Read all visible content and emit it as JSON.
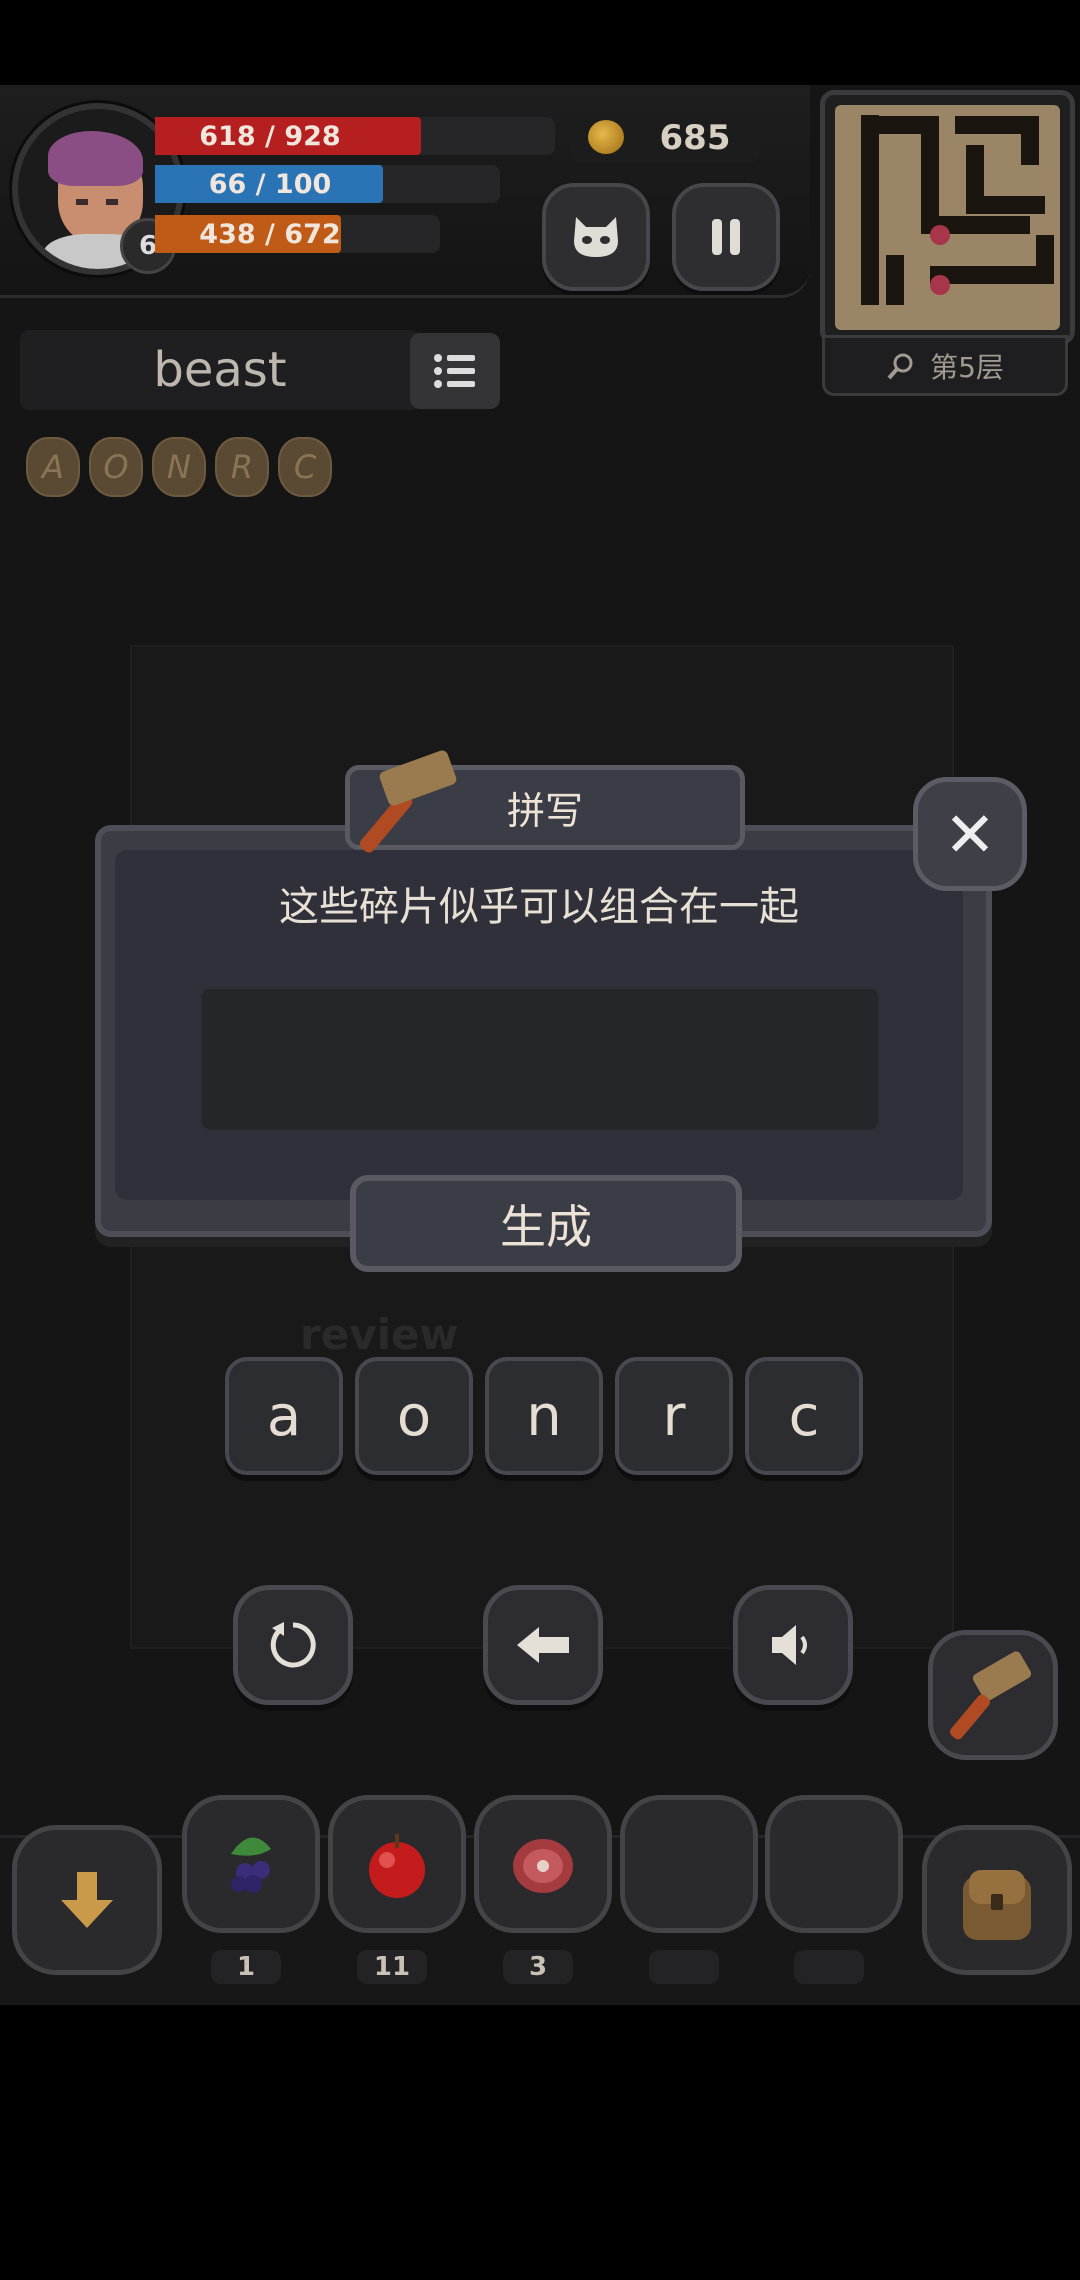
{
  "player": {
    "level": "6",
    "hp": "618 / 928",
    "hp_fraction": 0.666,
    "mp": "66 / 100",
    "mp_fraction": 0.66,
    "xp": "438 / 672",
    "xp_fraction": 0.652
  },
  "coins": "685",
  "floor_label": "第5层",
  "current_word": "beast",
  "fragments": [
    "A",
    "O",
    "N",
    "R",
    "C"
  ],
  "dialog": {
    "title": "拼写",
    "prompt": "这些碎片似乎可以组合在一起",
    "input_value": "",
    "generate_label": "生成",
    "close_symbol": "✕"
  },
  "background_text": "review",
  "letter_keys": [
    "a",
    "o",
    "n",
    "r",
    "c"
  ],
  "inventory": [
    {
      "item": "blackberry",
      "count": "1"
    },
    {
      "item": "apple",
      "count": "11"
    },
    {
      "item": "meat",
      "count": "3"
    },
    {
      "item": "empty",
      "count": ""
    },
    {
      "item": "empty",
      "count": ""
    }
  ],
  "colors": {
    "hp": "#b51f1f",
    "mp": "#2a73b5",
    "xp": "#c05a17",
    "panel": "#2f3039"
  }
}
